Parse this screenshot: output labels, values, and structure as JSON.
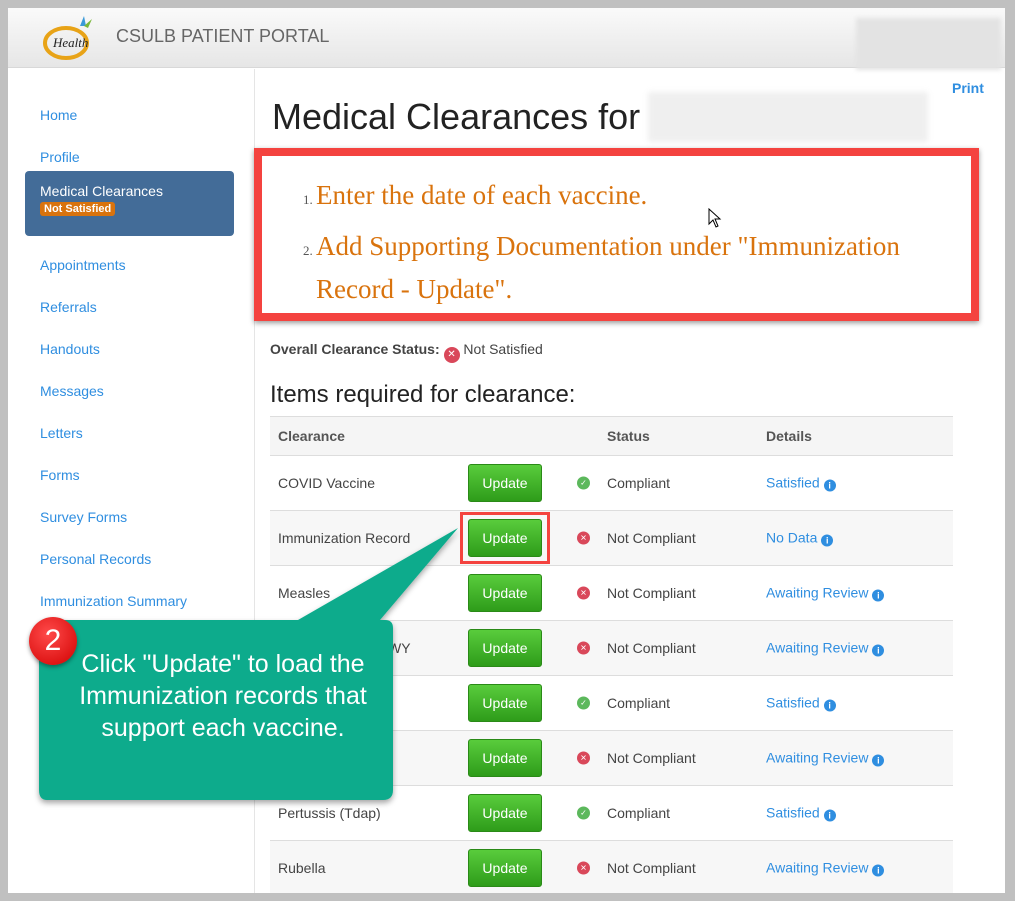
{
  "header": {
    "brand": "CSULB PATIENT PORTAL",
    "logo_text": "Student Health Services"
  },
  "sidebar": {
    "items": [
      {
        "label": "Home"
      },
      {
        "label": "Profile"
      },
      {
        "label": "Medical Clearances",
        "badge": "Not Satisfied",
        "active": true
      },
      {
        "label": "Appointments"
      },
      {
        "label": "Referrals"
      },
      {
        "label": "Handouts"
      },
      {
        "label": "Messages"
      },
      {
        "label": "Letters"
      },
      {
        "label": "Forms"
      },
      {
        "label": "Survey Forms"
      },
      {
        "label": "Personal Records"
      },
      {
        "label": "Immunization Summary"
      }
    ]
  },
  "main": {
    "print": "Print",
    "title": "Medical Clearances for",
    "instructions": [
      "Enter the date of each vaccine.",
      "Add Supporting Documentation under \"Immunization Record - Update\"."
    ],
    "overall_label": "Overall Clearance Status:",
    "overall_value": "Not Satisfied",
    "items_title": "Items required for clearance:",
    "columns": [
      "Clearance",
      "Status",
      "Details"
    ],
    "update_label": "Update",
    "rows": [
      {
        "name": "COVID Vaccine",
        "status": "Compliant",
        "details": "Satisfied",
        "ok": true
      },
      {
        "name": "Immunization Record",
        "status": "Not Compliant",
        "details": "No Data",
        "ok": false
      },
      {
        "name": "Measles",
        "status": "Not Compliant",
        "details": "Awaiting Review",
        "ok": false
      },
      {
        "name": "WY",
        "status": "Not Compliant",
        "details": "Awaiting Review",
        "ok": false
      },
      {
        "name": "",
        "status": "Compliant",
        "details": "Satisfied",
        "ok": true
      },
      {
        "name": "",
        "status": "Not Compliant",
        "details": "Awaiting Review",
        "ok": false
      },
      {
        "name": "Pertussis (Tdap)",
        "status": "Compliant",
        "details": "Satisfied",
        "ok": true
      },
      {
        "name": "Rubella",
        "status": "Not Compliant",
        "details": "Awaiting Review",
        "ok": false
      }
    ]
  },
  "callout": {
    "step": "2",
    "text": "Click \"Update\" to load the Immunization records that support each vaccine.",
    "color": "#0aab8c"
  },
  "colors": {
    "accent": "#2f8ee0",
    "sidebar_active": "#436c98",
    "warning": "#d9730d",
    "button": "#3aaa22",
    "highlight": "#f4433f"
  }
}
